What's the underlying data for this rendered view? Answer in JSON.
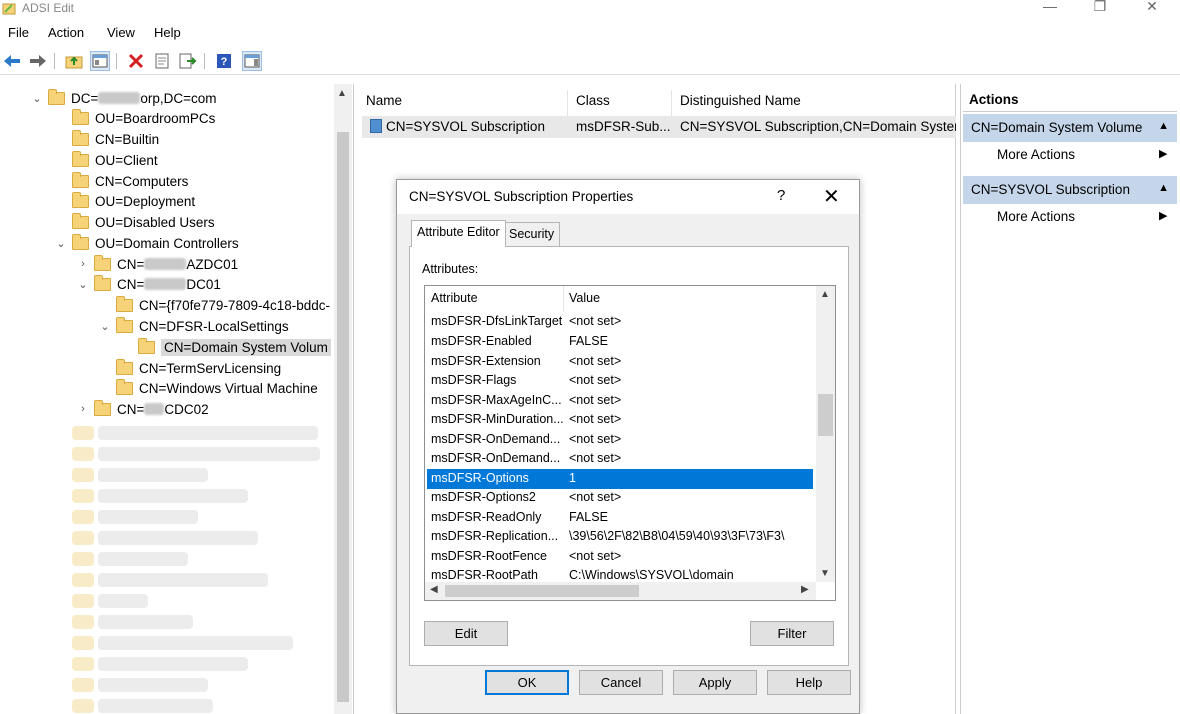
{
  "window": {
    "title": "ADSI Edit",
    "minimize": "—",
    "restore": "❐",
    "close": "✕"
  },
  "menu": [
    "File",
    "Action",
    "View",
    "Help"
  ],
  "tree": {
    "root": "DC=",
    "root_suffix": "orp,DC=com",
    "items": [
      {
        "label": "OU=BoardroomPCs"
      },
      {
        "label": "CN=Builtin"
      },
      {
        "label": "OU=Client"
      },
      {
        "label": "CN=Computers"
      },
      {
        "label": "OU=Deployment"
      },
      {
        "label": "OU=Disabled Users"
      },
      {
        "label": "OU=Domain Controllers"
      },
      {
        "label_prefix": "CN=",
        "label_suffix": "AZDC01"
      },
      {
        "label_prefix": "CN=",
        "label_suffix": "DC01"
      },
      {
        "label": "CN={f70fe779-7809-4c18-bddc-"
      },
      {
        "label": "CN=DFSR-LocalSettings"
      },
      {
        "label": "CN=Domain System Volum"
      },
      {
        "label": "CN=TermServLicensing"
      },
      {
        "label": "CN=Windows Virtual Machine"
      },
      {
        "label_prefix": "CN=",
        "label_suffix": "CDC02"
      }
    ]
  },
  "list": {
    "headers": {
      "name": "Name",
      "class": "Class",
      "dn": "Distinguished Name"
    },
    "row": {
      "name": "CN=SYSVOL Subscription",
      "class": "msDFSR-Sub...",
      "dn": "CN=SYSVOL Subscription,CN=Domain Syster"
    }
  },
  "actions": {
    "title": "Actions",
    "sections": [
      {
        "header": "CN=Domain System Volume",
        "item": "More Actions"
      },
      {
        "header": "CN=SYSVOL Subscription",
        "item": "More Actions"
      }
    ]
  },
  "dialog": {
    "title": "CN=SYSVOL Subscription Properties",
    "help": "?",
    "close": "✕",
    "tabs": [
      "Attribute Editor",
      "Security"
    ],
    "attributes_label": "Attributes:",
    "columns": {
      "attribute": "Attribute",
      "value": "Value"
    },
    "rows": [
      {
        "attribute": "msDFSR-DfsLinkTarget",
        "value": "<not set>"
      },
      {
        "attribute": "msDFSR-Enabled",
        "value": "FALSE"
      },
      {
        "attribute": "msDFSR-Extension",
        "value": "<not set>"
      },
      {
        "attribute": "msDFSR-Flags",
        "value": "<not set>"
      },
      {
        "attribute": "msDFSR-MaxAgeInC...",
        "value": "<not set>"
      },
      {
        "attribute": "msDFSR-MinDuration...",
        "value": "<not set>"
      },
      {
        "attribute": "msDFSR-OnDemand...",
        "value": "<not set>"
      },
      {
        "attribute": "msDFSR-OnDemand...",
        "value": "<not set>"
      },
      {
        "attribute": "msDFSR-Options",
        "value": "1",
        "selected": true
      },
      {
        "attribute": "msDFSR-Options2",
        "value": "<not set>"
      },
      {
        "attribute": "msDFSR-ReadOnly",
        "value": "FALSE"
      },
      {
        "attribute": "msDFSR-Replication...",
        "value": "\\39\\56\\2F\\82\\B8\\04\\59\\40\\93\\3F\\73\\F3\\"
      },
      {
        "attribute": "msDFSR-RootFence",
        "value": "<not set>"
      },
      {
        "attribute": "msDFSR-RootPath",
        "value": "C:\\Windows\\SYSVOL\\domain"
      }
    ],
    "buttons": {
      "edit": "Edit",
      "filter": "Filter",
      "ok": "OK",
      "cancel": "Cancel",
      "apply": "Apply",
      "help": "Help"
    }
  },
  "colors": {
    "selection": "#0078d7",
    "actions_header": "#c5d6ea",
    "folder": "#f6d378"
  }
}
